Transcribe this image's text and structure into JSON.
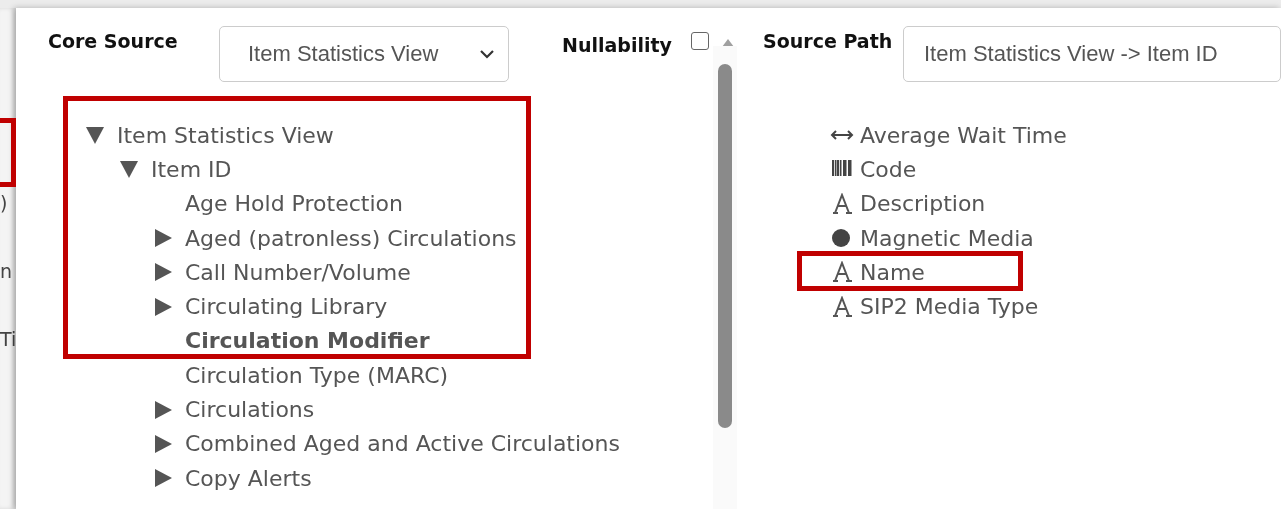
{
  "background_window": {
    "fragments": [
      ")",
      "n",
      "Ti"
    ]
  },
  "core_source": {
    "label": "Core Source",
    "value": "Item Statistics View"
  },
  "nullability": {
    "label": "Nullability",
    "checked": false
  },
  "source_path": {
    "label": "Source Path",
    "value": "Item Statistics View -> Item ID"
  },
  "tree": [
    {
      "label": "Item Statistics View",
      "kind": "group",
      "expanded": true,
      "selected": false,
      "children": [
        {
          "label": "Item ID",
          "kind": "group",
          "expanded": true,
          "selected": false,
          "children": [
            {
              "label": "Age Hold Protection",
              "kind": "field",
              "selected": false
            },
            {
              "label": "Aged (patronless) Circulations",
              "kind": "group",
              "expanded": false,
              "selected": false
            },
            {
              "label": "Call Number/Volume",
              "kind": "group",
              "expanded": false,
              "selected": false
            },
            {
              "label": "Circulating Library",
              "kind": "group",
              "expanded": false,
              "selected": false
            },
            {
              "label": "Circulation Modifier",
              "kind": "field",
              "selected": true
            },
            {
              "label": "Circulation Type (MARC)",
              "kind": "field",
              "selected": false
            },
            {
              "label": "Circulations",
              "kind": "group",
              "expanded": false,
              "selected": false
            },
            {
              "label": "Combined Aged and Active Circulations",
              "kind": "group",
              "expanded": false,
              "selected": false
            },
            {
              "label": "Copy Alerts",
              "kind": "group",
              "expanded": false,
              "selected": false
            }
          ]
        }
      ]
    }
  ],
  "fields": [
    {
      "label": "Average Wait Time",
      "kind": "interval"
    },
    {
      "label": "Code",
      "kind": "barcode"
    },
    {
      "label": "Description",
      "kind": "text"
    },
    {
      "label": "Magnetic Media",
      "kind": "bool"
    },
    {
      "label": "Name",
      "kind": "text"
    },
    {
      "label": "SIP2 Media Type",
      "kind": "text"
    }
  ]
}
